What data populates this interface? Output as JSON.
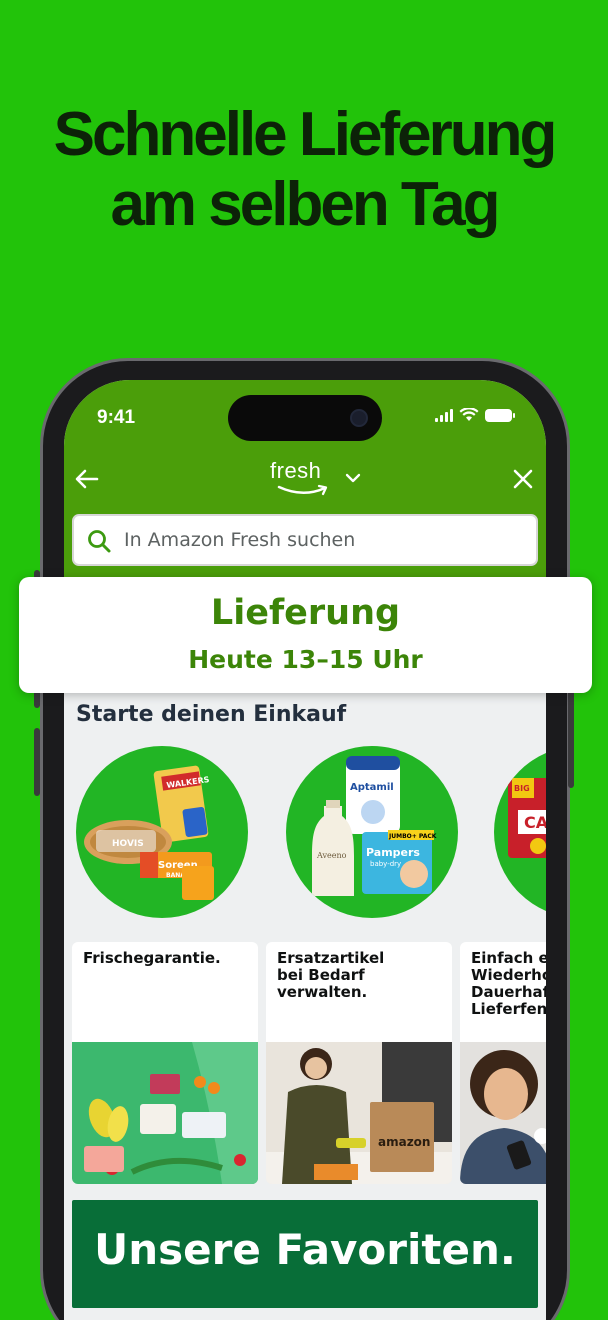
{
  "headline": {
    "line1": "Schnelle Lieferung",
    "line2": "am selben Tag"
  },
  "status_bar": {
    "time": "9:41"
  },
  "app_bar": {
    "logo": "fresh",
    "back_icon": "arrow-left-icon",
    "close_icon": "close-icon",
    "dropdown_icon": "chevron-down-icon"
  },
  "search": {
    "placeholder": "In Amazon Fresh suchen"
  },
  "delivery": {
    "title": "Lieferung",
    "time": "Heute 13–15 Uhr"
  },
  "section": {
    "title": "Starte deinen Einkauf"
  },
  "categories": [
    {
      "products": [
        "WALKERS",
        "HOVIS",
        "Soreen",
        "BANANA"
      ]
    },
    {
      "products": [
        "Aptamil",
        "Aveeno",
        "Pampers",
        "JUMBO+ PACK",
        "baby-dry"
      ]
    },
    {
      "products": [
        "BIG",
        "CAT"
      ]
    }
  ],
  "features": [
    {
      "label": "Frischegarantie."
    },
    {
      "label": "Ersatzartikel\nbei Bedarf\nverwalten.",
      "image_text": "amazon"
    },
    {
      "label": "Einfach ei\nWiederho\nDauerhaft\nLieferfens"
    }
  ],
  "favorites": {
    "label": "Unsere Favoriten."
  },
  "colors": {
    "background": "#22c30a",
    "app_bar": "#4b9e0a",
    "delivery_text": "#3c8508",
    "category_circle": "#22b525",
    "favorites_banner": "#086e38"
  }
}
